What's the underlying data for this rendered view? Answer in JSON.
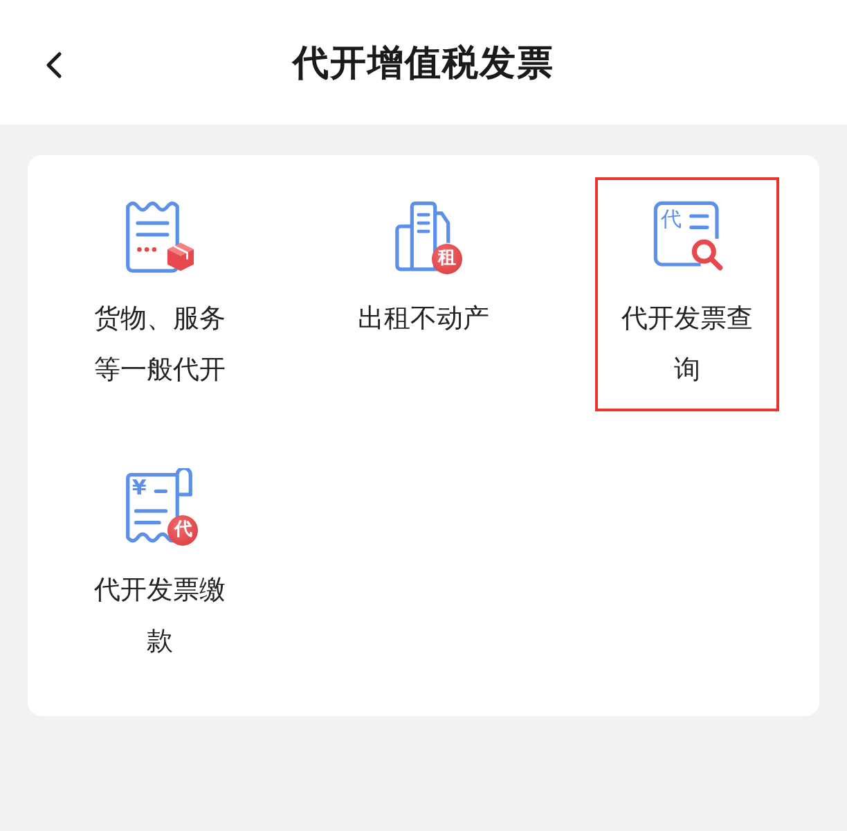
{
  "header": {
    "title": "代开增值税发票"
  },
  "items": [
    {
      "kind": "receipt-package",
      "label": "货物、服务等一般代开",
      "highlighted": false
    },
    {
      "kind": "building",
      "label": "出租不动产",
      "badge": "租",
      "highlighted": false
    },
    {
      "kind": "document-search",
      "label": "代开发票查询",
      "symbol": "代",
      "highlighted": true
    },
    {
      "kind": "receipt-yen",
      "label": "代开发票缴款",
      "symbol": "¥",
      "badge": "代",
      "highlighted": false
    }
  ]
}
